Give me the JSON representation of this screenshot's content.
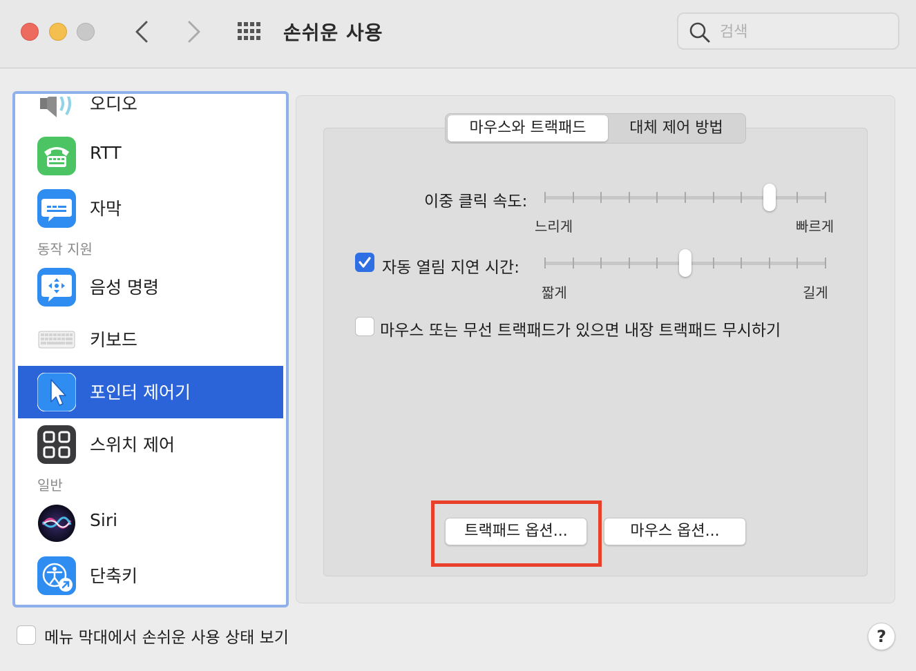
{
  "window": {
    "title": "손쉬운 사용",
    "search_placeholder": "검색"
  },
  "sidebar": {
    "items": [
      {
        "label": "오디오",
        "icon": "audio-icon"
      },
      {
        "label": "RTT",
        "icon": "rtt-phone-icon"
      },
      {
        "label": "자막",
        "icon": "captions-icon"
      },
      {
        "label": "음성 명령",
        "icon": "voice-control-icon"
      },
      {
        "label": "키보드",
        "icon": "keyboard-icon"
      },
      {
        "label": "포인터 제어기",
        "icon": "pointer-icon",
        "selected": true
      },
      {
        "label": "스위치 제어",
        "icon": "switch-control-icon"
      },
      {
        "label": "Siri",
        "icon": "siri-icon"
      },
      {
        "label": "단축키",
        "icon": "accessibility-shortcut-icon"
      }
    ],
    "sections": {
      "motor": "동작 지원",
      "general": "일반"
    }
  },
  "tabs": {
    "mouse_trackpad": "마우스와 트랙패드",
    "alternate_control": "대체 제어 방법"
  },
  "double_click": {
    "label": "이중 클릭 속도:",
    "min_label": "느리게",
    "max_label": "빠르게",
    "value": 0.8
  },
  "spring_loading": {
    "label": "자동 열림 지연 시간:",
    "checked": true,
    "min_label": "짧게",
    "max_label": "길게",
    "value": 0.5
  },
  "ignore_trackpad": {
    "label": "마우스 또는 무선 트랙패드가 있으면 내장 트랙패드 무시하기",
    "checked": false
  },
  "buttons": {
    "trackpad_options": "트랙패드 옵션...",
    "mouse_options": "마우스 옵션..."
  },
  "footer": {
    "show_in_menu_bar": "메뉴 막대에서 손쉬운 사용 상태 보기",
    "show_in_menu_bar_checked": false,
    "help": "?"
  },
  "colors": {
    "selection": "#2b63d9",
    "checkbox_on": "#2f6fe4",
    "highlight": "#e8402b"
  }
}
